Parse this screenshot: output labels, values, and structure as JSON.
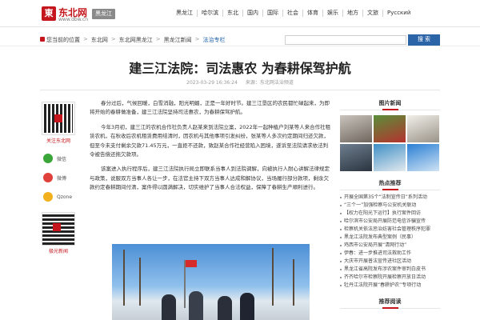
{
  "header": {
    "logo_mark": "東",
    "logo_text": "东北网",
    "logo_url": "www.dbw.cn",
    "region": "黑龙江",
    "nav": [
      "黑龙江",
      "哈尔滨",
      "东北",
      "国内",
      "国际",
      "社会",
      "体育",
      "娱乐",
      "地方",
      "文旅",
      "Русский"
    ]
  },
  "breadcrumb": {
    "items": [
      "您当前的位置",
      "东北网",
      "东北网黑龙江",
      "黑龙江新闻",
      "法治专栏"
    ],
    "current": "法治专栏"
  },
  "search": {
    "placeholder": "",
    "button": "搜 索"
  },
  "article": {
    "title": "建三江法院：司法惠农 为春耕保驾护航",
    "date": "2023-03-29 16:36:24",
    "source": "来源：东北网法治频道",
    "paragraphs": [
      "春分过后，气候回暖，白雪消融，阳光明媚，正是一年好时节。建三江垦区的农民都忙碌起来，为即将开始的春耕做准备，建三江法院坚持司法惠农，为春耕保驾护航。",
      "今年3月初，建三江的农机合作社负责人赵某来到法院立案，2022年一起种植户刘某等人来合作社租赁农机，在秋收后农机租赁费用结清时，因农机与其他事项引发纠纷，张某等人多次约定期间归还欠款，但至今未支付剩余欠款71.45万元，一直拒不还款，致赵某合作社经营陷入困境，遂诉至法院请求依法判令被告偿还拖欠款项。",
      "该案进入执行程序后，建三江法院执行局立即联系当事人到法院调解，向被执行人耐心讲解法律规定与政策，说服双方当事人各让一步，在法官主持下双方当事人达成和解协议，当场履行部分款项，剩余欠款约定春耕期间付清，案件得以圆满解决，切实维护了当事人合法权益，保障了春耕生产顺利进行。"
    ]
  },
  "share": {
    "qr_label": "关注东北网",
    "items": [
      {
        "name": "微信",
        "color": "#3aa63a",
        "icon": "wechat-icon"
      },
      {
        "name": "微博",
        "color": "#e0403a",
        "icon": "weibo-icon"
      },
      {
        "name": "Qzone",
        "color": "#f2b01e",
        "icon": "qzone-icon"
      }
    ],
    "qr2_label": "极光新闻"
  },
  "sidebar": {
    "pic_head": "图片新闻",
    "news_head": "热点推荐",
    "news": [
      "开展全国第35个“法制宣传日”系列活动",
      "“三个一”加强检察与公安机关联动",
      "【权力在阳光下运行】执行案件回访",
      "哈尔滨市公安局开展防范电信诈骗宣传",
      "检察机关依法惩治妨害社会管理秩序犯罪",
      "黑龙江法院发布典型案例（民事）",
      "鸡西市公安局开展“清网行动”",
      "伊春：进一步推进司法救助工作",
      "大庆市开展普法宣传进社区活动",
      "黑龙江省高院发布涉农案件审判白皮书",
      "齐齐哈尔市检察院开展检察开放日活动",
      "牡丹江法院开展“春耕护农”专项行动"
    ],
    "bottom_head": "推荐阅读"
  }
}
